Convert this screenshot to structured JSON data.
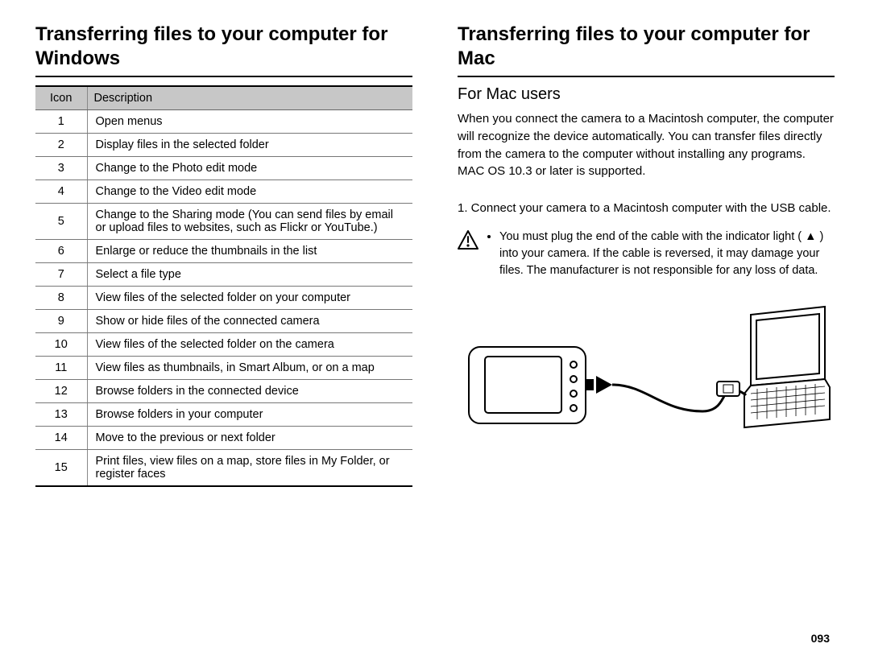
{
  "left": {
    "heading": "Transferring files to your computer for Windows",
    "table": {
      "headers": {
        "icon": "Icon",
        "description": "Description"
      },
      "rows": [
        {
          "icon": "1",
          "desc": "Open menus"
        },
        {
          "icon": "2",
          "desc": "Display files in the selected folder"
        },
        {
          "icon": "3",
          "desc": "Change to the Photo edit mode"
        },
        {
          "icon": "4",
          "desc": "Change to the Video edit mode"
        },
        {
          "icon": "5",
          "desc": "Change to the Sharing mode (You can send files by email or upload files to websites, such as Flickr or YouTube.)"
        },
        {
          "icon": "6",
          "desc": "Enlarge or reduce the thumbnails in the list"
        },
        {
          "icon": "7",
          "desc": "Select a file type"
        },
        {
          "icon": "8",
          "desc": "View files of the selected folder on your computer"
        },
        {
          "icon": "9",
          "desc": "Show or hide files of the connected camera"
        },
        {
          "icon": "10",
          "desc": "View files of the selected folder on the camera"
        },
        {
          "icon": "11",
          "desc": "View files as thumbnails, in Smart Album, or on a map"
        },
        {
          "icon": "12",
          "desc": "Browse folders in the connected device"
        },
        {
          "icon": "13",
          "desc": "Browse folders in your computer"
        },
        {
          "icon": "14",
          "desc": "Move to the previous or next folder"
        },
        {
          "icon": "15",
          "desc": "Print files, view files on a map, store files in My Folder, or register faces"
        }
      ]
    }
  },
  "right": {
    "heading": "Transferring files to your computer for Mac",
    "subheading": "For Mac users",
    "paragraph": "When you connect the camera to a Macintosh computer, the computer will recognize the device automatically. You can transfer files directly from the camera to the computer without installing any programs. MAC OS 10.3 or later is supported.",
    "step1": "1. Connect your camera to a Macintosh computer with the USB cable.",
    "caution": "You must plug the end of the cable with the indicator light ( ▲ ) into your camera. If the cable is reversed, it may damage your files. The manufacturer is not responsible for any loss of data."
  },
  "page_number": "093"
}
